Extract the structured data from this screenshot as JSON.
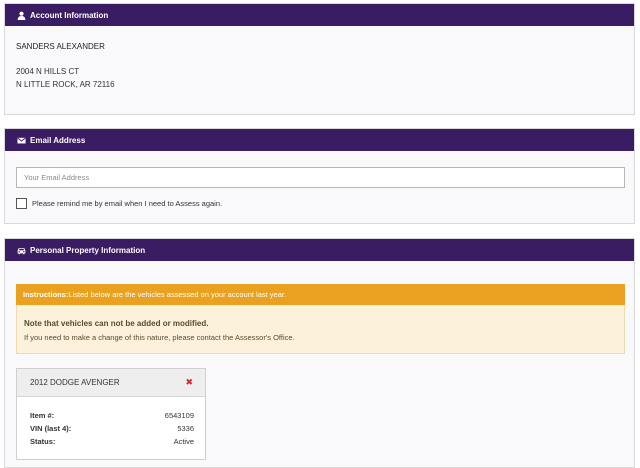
{
  "account": {
    "heading": "Account Information",
    "icon": "user-icon",
    "name": "SANDERS ALEXANDER",
    "address_line1": "2004 N HILLS CT",
    "address_line2": "N LITTLE ROCK, AR 72116"
  },
  "email": {
    "heading": "Email Address",
    "icon": "envelope-icon",
    "placeholder": "Your Email Address",
    "value": "",
    "remind_label": "Please remind me by email when I need to Assess again.",
    "remind_checked": false
  },
  "property": {
    "heading": "Personal Property Information",
    "icon": "car-icon",
    "instructions_label": "Instructions:",
    "instructions_text": "Listed below are the vehicles assessed on your account last year.",
    "note_title": "Note that vehicles can not be added or modified.",
    "note_text": "If you need to make a change of this nature, please contact the Assessor's Office.",
    "vehicles": [
      {
        "title": "2012 DODGE AVENGER",
        "item_label": "Item #:",
        "item_value": "6543109",
        "vin_label": "VIN (last 4):",
        "vin_value": "5336",
        "status_label": "Status:",
        "status_value": "Active"
      }
    ]
  },
  "colors": {
    "header_bg": "#3a1c63",
    "instructions_bg": "#e9a11f",
    "note_bg": "#fcf2dc",
    "remove_icon": "#d9262a"
  }
}
